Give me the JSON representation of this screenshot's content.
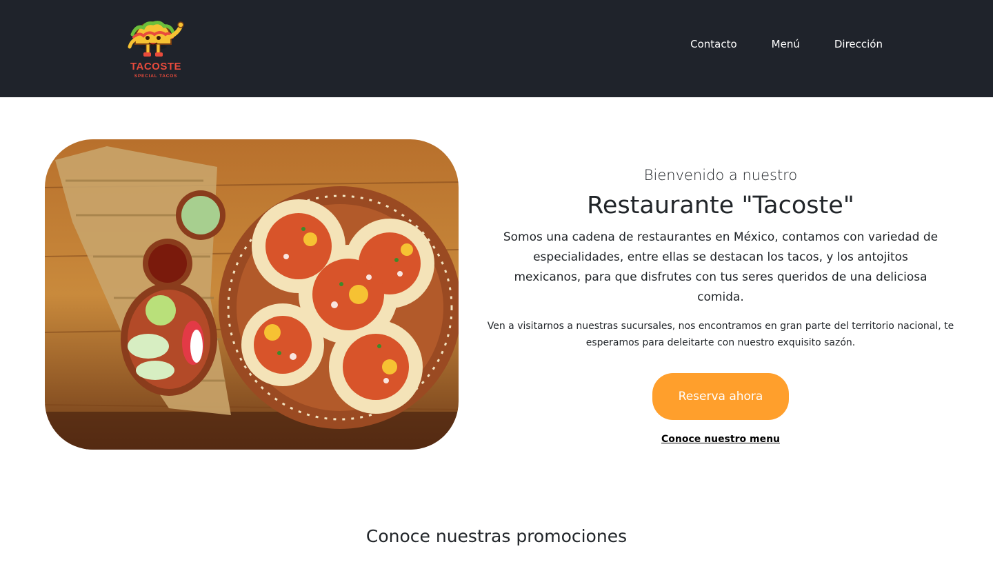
{
  "header": {
    "logo": {
      "title": "TACOSTE",
      "subtitle": "SPECIAL TACOS"
    },
    "nav": [
      {
        "label": "Contacto"
      },
      {
        "label": "Menú"
      },
      {
        "label": "Dirección"
      }
    ]
  },
  "hero": {
    "image": {
      "icon": "tacos-photo"
    },
    "welcome": "Bienvenido a nuestro",
    "title": "Restaurante \"Tacoste\"",
    "lead": "Somos una cadena de restaurantes en México, contamos con variedad de especialidades, entre ellas se destacan los tacos, y los antojitos mexicanos, para que disfrutes con tus seres queridos de una deliciosa comida.",
    "small": "Ven a visitarnos a nuestras sucursales, nos encontramos en gran parte del territorio nacional, te esperamos para deleitarte con nuestro exquisito sazón.",
    "cta_label": "Reserva ahora",
    "menu_link_label": "Conoce nuestro menu"
  },
  "promotions": {
    "heading": "Conoce nuestras promociones"
  },
  "colors": {
    "header_bg": "#1f232b",
    "accent": "#ff9f2c",
    "logo_red": "#e94b3c",
    "text": "#212529"
  }
}
